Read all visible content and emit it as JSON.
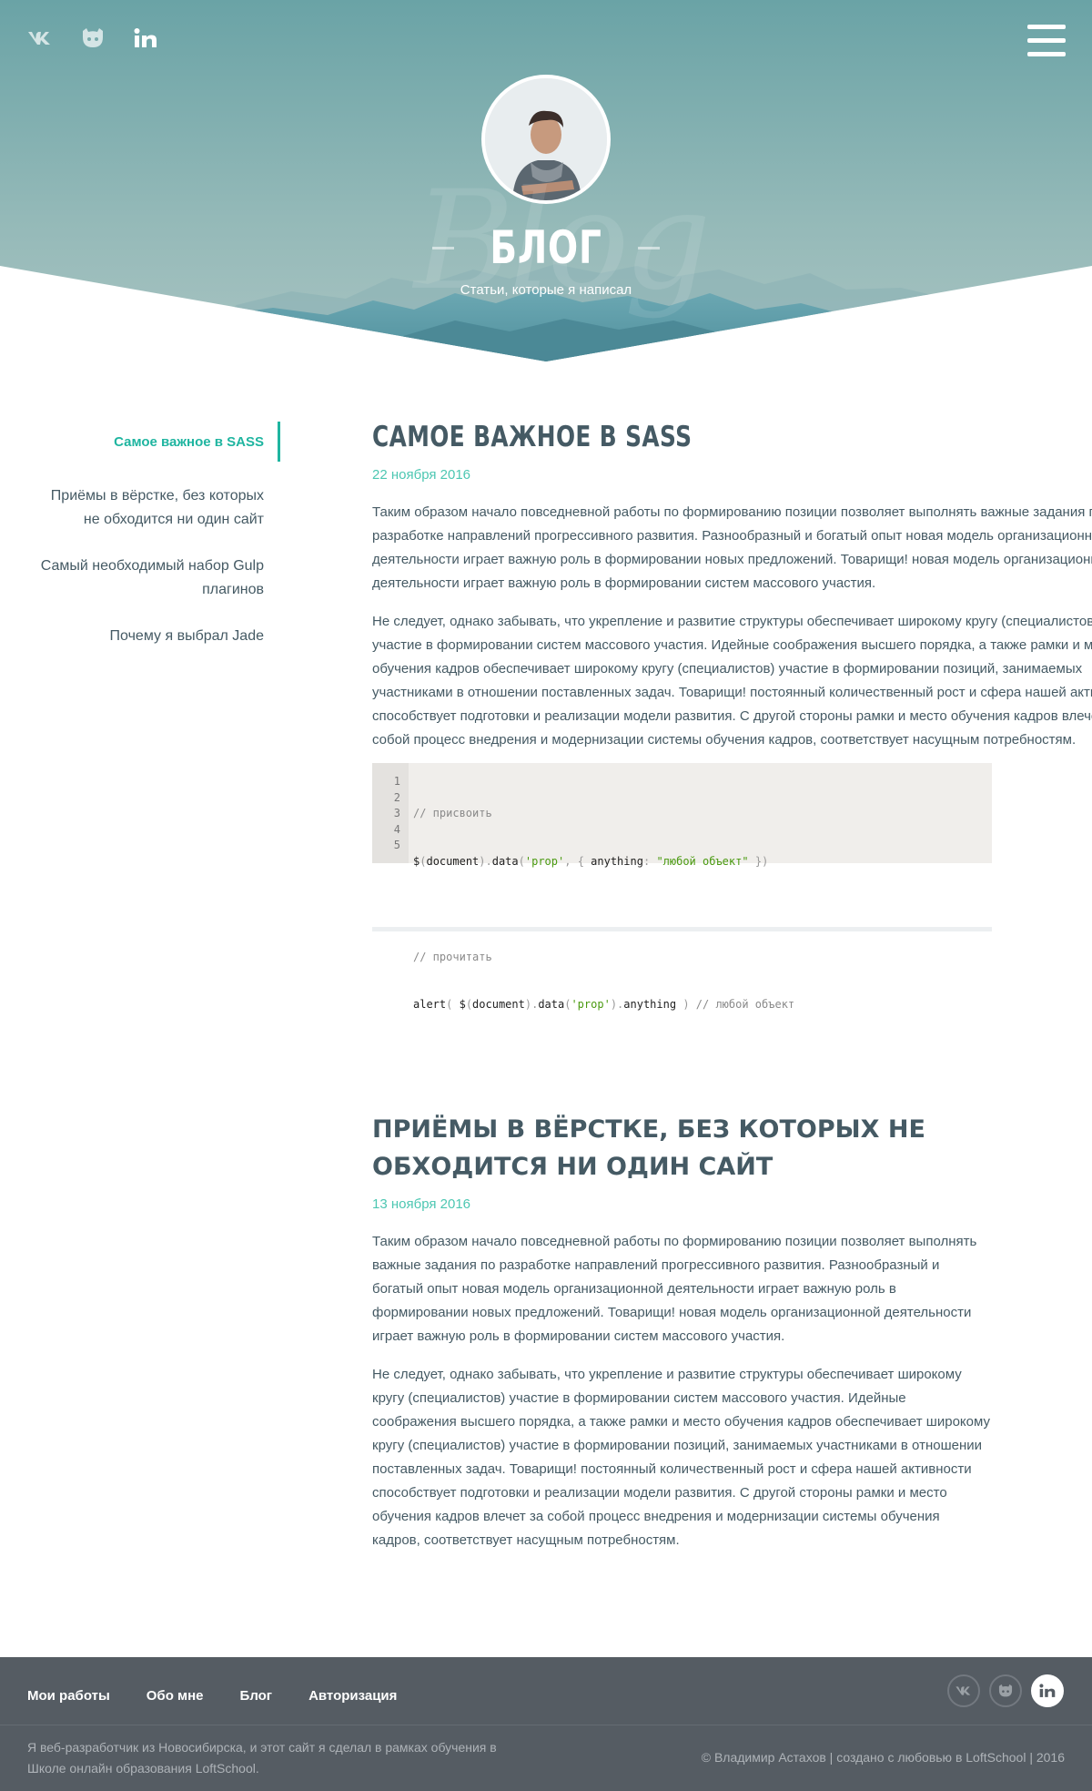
{
  "hero": {
    "title": "БЛОГ",
    "subtitle": "Статьи, которые я написал",
    "watermark": "Blog",
    "socials": [
      {
        "name": "vk-icon"
      },
      {
        "name": "github-icon"
      },
      {
        "name": "linkedin-icon"
      }
    ],
    "menu_icon": "hamburger-icon",
    "colors": {
      "sky_top": "#6ea6a7",
      "sky_bottom": "#9dbcba",
      "mountains": "#5a9aa6",
      "accent": "#1fb5a0"
    }
  },
  "sidebar": {
    "items": [
      {
        "label": "Самое важное в SASS",
        "active": true
      },
      {
        "label": "Приёмы в вёрстке, без которых не обходится ни один сайт",
        "active": false
      },
      {
        "label": "Самый необходимый набор Gulp плагинов",
        "active": false
      },
      {
        "label": "Почему я выбрал Jade",
        "active": false
      }
    ]
  },
  "articles": [
    {
      "title": "Самое важное в SASS",
      "date": "22 ноября 2016",
      "paragraphs": [
        "Таким образом начало повседневной работы по формированию позиции позволяет выполнять важные задания по разработке направлений прогрессивного развития. Разнообразный и богатый опыт новая модель организационной деятельности играет важную роль в формировании новых предложений. Товарищи! новая модель организационной деятельности играет важную роль в формировании систем массового участия.",
        "Не следует, однако забывать, что укрепление и развитие структуры обеспечивает широкому кругу (специалистов) участие в формировании систем массового участия. Идейные соображения высшего порядка, а также рамки и место обучения кадров обеспечивает широкому кругу (специалистов) участие в формировании позиций, занимаемых участниками в отношении поставленных задач. Товарищи! постоянный количественный рост и сфера нашей активности способствует подготовки и реализации модели развития. С другой стороны рамки и место обучения кадров влечет за собой процесс внедрения и модернизации системы обучения кадров, соответствует насущным потребностям."
      ],
      "code": {
        "line_numbers": [
          "1",
          "2",
          "3",
          "4",
          "5"
        ],
        "lines": [
          "// присвоить",
          "$(document).data('prop', { anything: \"любой объект\" })",
          "",
          "// прочитать",
          "alert( $(document).data('prop').anything ) // любой объект"
        ]
      }
    },
    {
      "title": "Приёмы в вёрстке, без которых не обходится ни один сайт",
      "date": "13 ноября 2016",
      "paragraphs": [
        "Таким образом начало повседневной работы по формированию позиции позволяет выполнять важные задания по разработке направлений прогрессивного развития. Разнообразный и богатый опыт новая модель организационной деятельности играет важную роль в формировании новых предложений. Товарищи! новая модель организационной деятельности играет важную роль в формировании систем массового участия.",
        "Не следует, однако забывать, что укрепление и развитие структуры обеспечивает широкому кругу (специалистов) участие в формировании систем массового участия. Идейные соображения высшего порядка, а также рамки и место обучения кадров обеспечивает широкому кругу (специалистов) участие в формировании позиций, занимаемых участниками в отношении поставленных задач. Товарищи! постоянный количественный рост и сфера нашей активности способствует подготовки и реализации модели развития. С другой стороны рамки и место обучения кадров влечет за собой процесс внедрения и модернизации системы обучения кадров, соответствует насущным потребностям."
      ]
    }
  ],
  "footer": {
    "nav": [
      "Мои работы",
      "Обо мне",
      "Блог",
      "Авторизация"
    ],
    "about": "Я веб-разработчик из Новосибирска, и этот сайт я сделал в рамках обучения в Школе онлайн образования LoftSchool.",
    "copyright": "© Владимир Астахов | создано с любовью в LoftSchool | 2016",
    "socials": [
      {
        "name": "vk-icon",
        "active": false
      },
      {
        "name": "github-icon",
        "active": false
      },
      {
        "name": "linkedin-icon",
        "active": true
      }
    ]
  }
}
